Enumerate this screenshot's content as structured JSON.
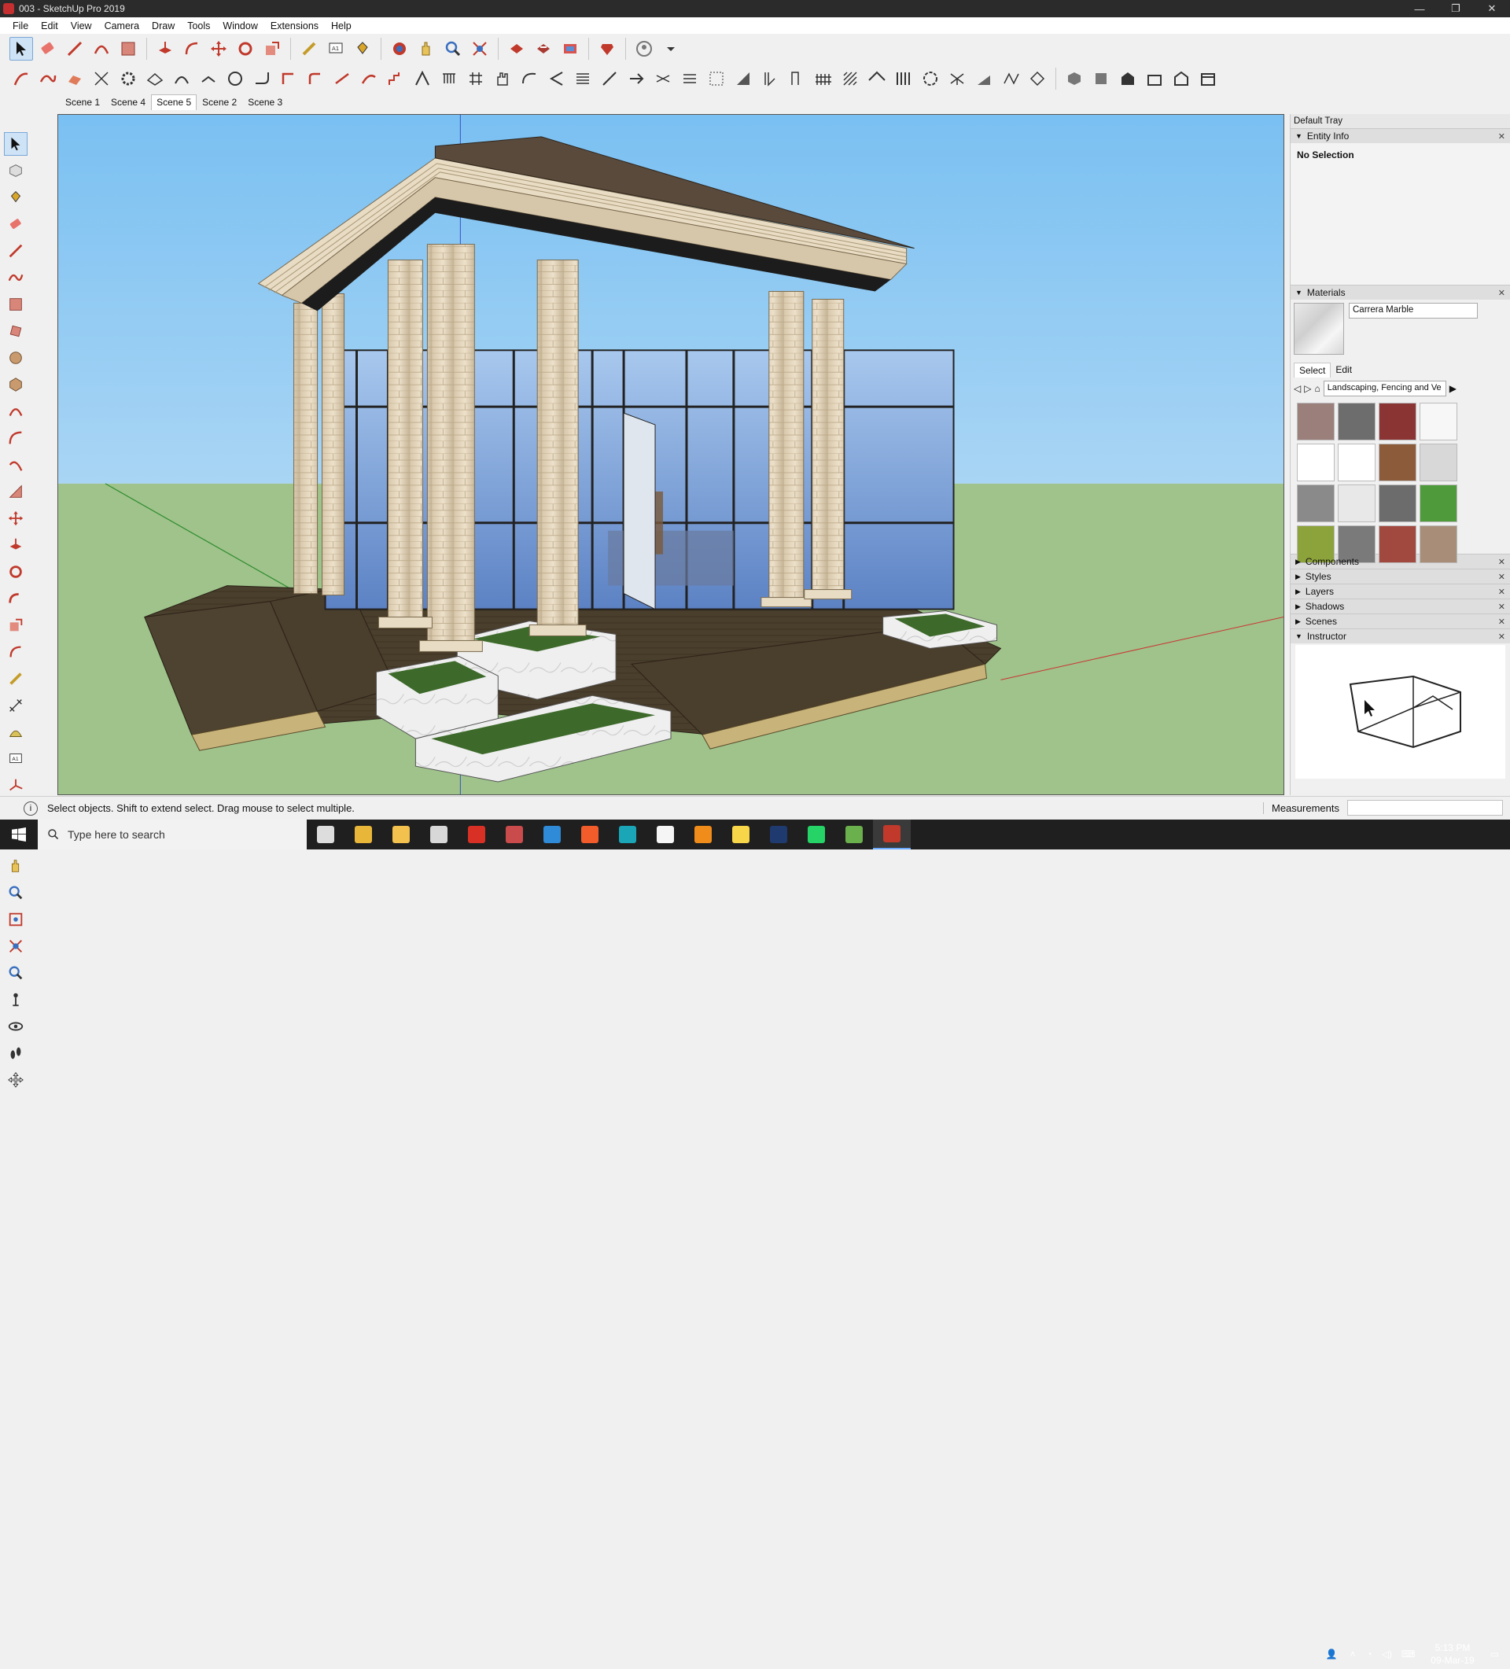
{
  "window": {
    "title": "003 - SketchUp Pro 2019",
    "controls": [
      "—",
      "❐",
      "✕"
    ]
  },
  "menu": [
    "File",
    "Edit",
    "View",
    "Camera",
    "Draw",
    "Tools",
    "Window",
    "Extensions",
    "Help"
  ],
  "scenes": {
    "tabs": [
      "Scene 1",
      "Scene 4",
      "Scene 5",
      "Scene 2",
      "Scene 3"
    ],
    "selected": "Scene 5"
  },
  "tray": {
    "title": "Default Tray",
    "entity_info": {
      "label": "Entity Info",
      "value": "No Selection"
    },
    "materials": {
      "label": "Materials",
      "current_name": "Carrera Marble",
      "tabs": [
        "Select",
        "Edit"
      ],
      "library": "Landscaping, Fencing and Ve",
      "swatch_colors": [
        "#9a7f7b",
        "#6d6d6d",
        "#8b3434",
        "#f7f7f7",
        "#ffffff",
        "#ffffff",
        "#8c5b3a",
        "#d8d8d8",
        "#8a8a8a",
        "#e8e8e8",
        "#6c6c6c",
        "#4f9a3a",
        "#8ca23a",
        "#7a7a7a",
        "#a2493f",
        "#a88e78"
      ]
    },
    "panels": [
      "Components",
      "Styles",
      "Layers",
      "Shadows",
      "Scenes",
      "Instructor"
    ]
  },
  "status": {
    "message": "Select objects. Shift to extend select. Drag mouse to select multiple.",
    "measurements_label": "Measurements",
    "measurements_value": ""
  },
  "taskbar": {
    "search_placeholder": "Type here to search",
    "apps": [
      {
        "name": "task-view",
        "color": "#dddddd"
      },
      {
        "name": "chrome",
        "color": "#e8b73a"
      },
      {
        "name": "file-explorer",
        "color": "#f2c14e"
      },
      {
        "name": "calculator",
        "color": "#d8d8d8"
      },
      {
        "name": "acrobat",
        "color": "#d93025"
      },
      {
        "name": "app-red-sphere",
        "color": "#c94b4b"
      },
      {
        "name": "edge",
        "color": "#2f8bd8"
      },
      {
        "name": "brave",
        "color": "#f25c2a"
      },
      {
        "name": "sketchup-3",
        "color": "#1aa6b7"
      },
      {
        "name": "notes",
        "color": "#f5f5f5"
      },
      {
        "name": "vlc",
        "color": "#f08c1a"
      },
      {
        "name": "sticky-notes",
        "color": "#f7d64a"
      },
      {
        "name": "photoshop",
        "color": "#1f3a6f"
      },
      {
        "name": "whatsapp",
        "color": "#25d366"
      },
      {
        "name": "app-green",
        "color": "#6ab04c"
      },
      {
        "name": "sketchup",
        "color": "#c0392b"
      }
    ],
    "time": "5:13 PM",
    "date": "09-Mar-19"
  }
}
